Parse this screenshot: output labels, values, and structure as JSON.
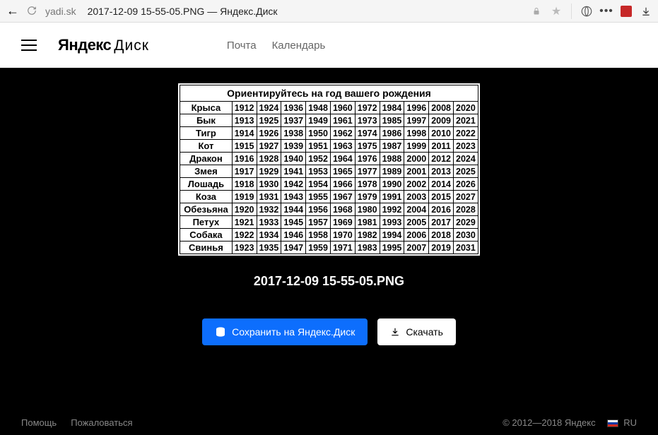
{
  "browser": {
    "domain": "yadi.sk",
    "title": "2017-12-09 15-55-05.PNG — Яндекс.Диск"
  },
  "header": {
    "logo_bold": "Яндекс",
    "logo_thin": "Диск",
    "nav_mail": "Почта",
    "nav_calendar": "Календарь"
  },
  "zodiac": {
    "caption": "Ориентируйтесь на год вашего рождения",
    "rows": [
      {
        "animal": "Крыса",
        "years": [
          "1912",
          "1924",
          "1936",
          "1948",
          "1960",
          "1972",
          "1984",
          "1996",
          "2008",
          "2020"
        ]
      },
      {
        "animal": "Бык",
        "years": [
          "1913",
          "1925",
          "1937",
          "1949",
          "1961",
          "1973",
          "1985",
          "1997",
          "2009",
          "2021"
        ]
      },
      {
        "animal": "Тигр",
        "years": [
          "1914",
          "1926",
          "1938",
          "1950",
          "1962",
          "1974",
          "1986",
          "1998",
          "2010",
          "2022"
        ]
      },
      {
        "animal": "Кот",
        "years": [
          "1915",
          "1927",
          "1939",
          "1951",
          "1963",
          "1975",
          "1987",
          "1999",
          "2011",
          "2023"
        ]
      },
      {
        "animal": "Дракон",
        "years": [
          "1916",
          "1928",
          "1940",
          "1952",
          "1964",
          "1976",
          "1988",
          "2000",
          "2012",
          "2024"
        ]
      },
      {
        "animal": "Змея",
        "years": [
          "1917",
          "1929",
          "1941",
          "1953",
          "1965",
          "1977",
          "1989",
          "2001",
          "2013",
          "2025"
        ]
      },
      {
        "animal": "Лошадь",
        "years": [
          "1918",
          "1930",
          "1942",
          "1954",
          "1966",
          "1978",
          "1990",
          "2002",
          "2014",
          "2026"
        ]
      },
      {
        "animal": "Коза",
        "years": [
          "1919",
          "1931",
          "1943",
          "1955",
          "1967",
          "1979",
          "1991",
          "2003",
          "2015",
          "2027"
        ]
      },
      {
        "animal": "Обезьяна",
        "years": [
          "1920",
          "1932",
          "1944",
          "1956",
          "1968",
          "1980",
          "1992",
          "2004",
          "2016",
          "2028"
        ]
      },
      {
        "animal": "Петух",
        "years": [
          "1921",
          "1933",
          "1945",
          "1957",
          "1969",
          "1981",
          "1993",
          "2005",
          "2017",
          "2029"
        ]
      },
      {
        "animal": "Собака",
        "years": [
          "1922",
          "1934",
          "1946",
          "1958",
          "1970",
          "1982",
          "1994",
          "2006",
          "2018",
          "2030"
        ]
      },
      {
        "animal": "Свинья",
        "years": [
          "1923",
          "1935",
          "1947",
          "1959",
          "1971",
          "1983",
          "1995",
          "2007",
          "2019",
          "2031"
        ]
      }
    ]
  },
  "file": {
    "name": "2017-12-09 15-55-05.PNG"
  },
  "actions": {
    "save": "Сохранить на Яндекс.Диск",
    "download": "Скачать"
  },
  "footer": {
    "help": "Помощь",
    "report": "Пожаловаться",
    "copyright": "© 2012—2018 Яндекс",
    "lang": "RU"
  }
}
